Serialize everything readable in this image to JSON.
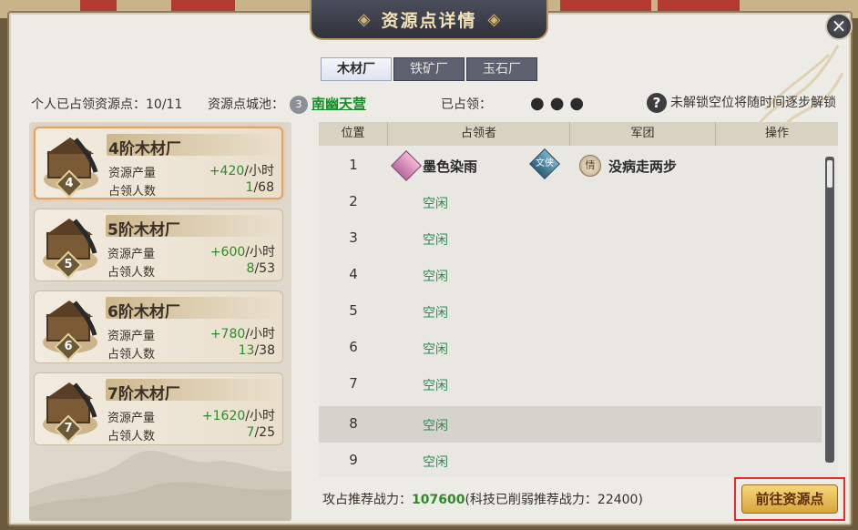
{
  "dialog": {
    "title": "资源点详情",
    "close_label": "×"
  },
  "tabs": [
    {
      "label": "木材厂",
      "active": true
    },
    {
      "label": "铁矿厂",
      "active": false
    },
    {
      "label": "玉石厂",
      "active": false
    }
  ],
  "info": {
    "occupied_label": "个人已占领资源点：",
    "occupied_value": "10/11",
    "city_label": "资源点城池：",
    "city_icon_text": "3",
    "city_name": "南幽天营",
    "held_label": "已占领：",
    "held_dots": "●●●",
    "hint": "未解锁空位将随时间逐步解锁"
  },
  "cards": [
    {
      "name": "4阶木材厂",
      "level": "4",
      "output_label": "资源产量",
      "output_value": "+420",
      "output_unit": "/小时",
      "occupants_label": "占领人数",
      "occupants_current": "1",
      "occupants_total": "/68",
      "selected": true
    },
    {
      "name": "5阶木材厂",
      "level": "5",
      "output_label": "资源产量",
      "output_value": "+600",
      "output_unit": "/小时",
      "occupants_label": "占领人数",
      "occupants_current": "8",
      "occupants_total": "/53",
      "selected": false
    },
    {
      "name": "6阶木材厂",
      "level": "6",
      "output_label": "资源产量",
      "output_value": "+780",
      "output_unit": "/小时",
      "occupants_label": "占领人数",
      "occupants_current": "13",
      "occupants_total": "/38",
      "selected": false
    },
    {
      "name": "7阶木材厂",
      "level": "7",
      "output_label": "资源产量",
      "output_value": "+1620",
      "output_unit": "/小时",
      "occupants_label": "占领人数",
      "occupants_current": "7",
      "occupants_total": "/25",
      "selected": false
    }
  ],
  "table": {
    "headers": [
      "位置",
      "占领者",
      "军团",
      "操作"
    ],
    "rows": [
      {
        "pos": "1",
        "occupier": "墨色染雨",
        "job_icon_text": "文侠",
        "legion_icon_text": "情",
        "legion": "没病走两步"
      },
      {
        "pos": "2",
        "status": "空闲"
      },
      {
        "pos": "3",
        "status": "空闲"
      },
      {
        "pos": "4",
        "status": "空闲"
      },
      {
        "pos": "5",
        "status": "空闲"
      },
      {
        "pos": "6",
        "status": "空闲"
      },
      {
        "pos": "7",
        "status": "空闲"
      },
      {
        "pos": "8",
        "status": "空闲"
      },
      {
        "pos": "9",
        "status": "空闲"
      }
    ]
  },
  "footer": {
    "power_label": "攻占推荐战力：",
    "power_value": "107600",
    "power_note": "(科技已削弱推荐战力：22400)",
    "goto_label": "前往资源点"
  },
  "colors": {
    "accent_green": "#2f8a2a",
    "idle_green": "#2c8b53",
    "highlight_red": "#e52b2b",
    "button_gold": "#d9a43a"
  }
}
